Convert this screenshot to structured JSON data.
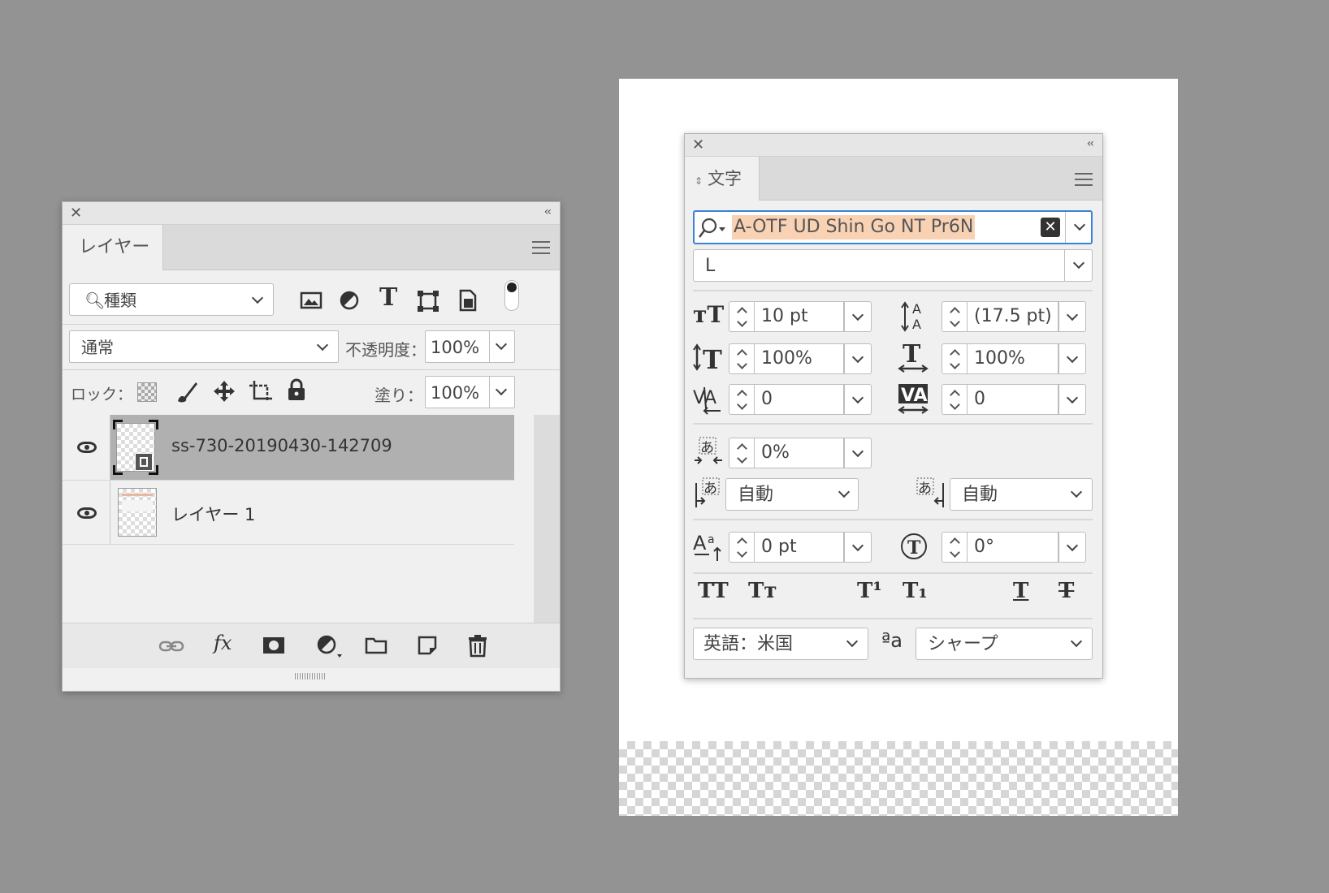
{
  "layers_panel": {
    "tab": "レイヤー",
    "filter": {
      "label": "種類"
    },
    "filter_icons": [
      "image-filter-icon",
      "adjustment-filter-icon",
      "type-filter-icon",
      "shape-filter-icon",
      "smart-object-filter-icon"
    ],
    "blend_mode": "通常",
    "opacity_label": "不透明度：",
    "opacity_value": "100%",
    "lock_label": "ロック：",
    "fill_label": "塗り：",
    "fill_value": "100%",
    "layers": [
      {
        "name": "ss-730-20190430-142709",
        "selected": true,
        "visible": true,
        "smart_object": true
      },
      {
        "name": "レイヤー 1",
        "selected": false,
        "visible": true,
        "smart_object": false
      }
    ],
    "footer_icons": [
      "link-icon",
      "fx-icon",
      "mask-icon",
      "adjustment-icon",
      "folder-icon",
      "new-layer-icon",
      "trash-icon"
    ],
    "fx_label": "fx"
  },
  "character_panel": {
    "tab": "文字",
    "font_family": "A-OTF UD Shin Go NT Pr6N",
    "font_style": "L",
    "font_size": "10 pt",
    "leading": "(17.5 pt)",
    "vertical_scale": "100%",
    "horizontal_scale": "100%",
    "kerning": "0",
    "tracking": "0",
    "tsume": "0%",
    "aki_before": "自動",
    "aki_after": "自動",
    "baseline_shift": "0 pt",
    "rotation": "0°",
    "style_buttons": [
      "TT",
      "Tт",
      "T¹",
      "T₁",
      "T",
      "T"
    ],
    "language": "英語：米国",
    "aa_label": "ªa",
    "antialias": "シャープ"
  }
}
